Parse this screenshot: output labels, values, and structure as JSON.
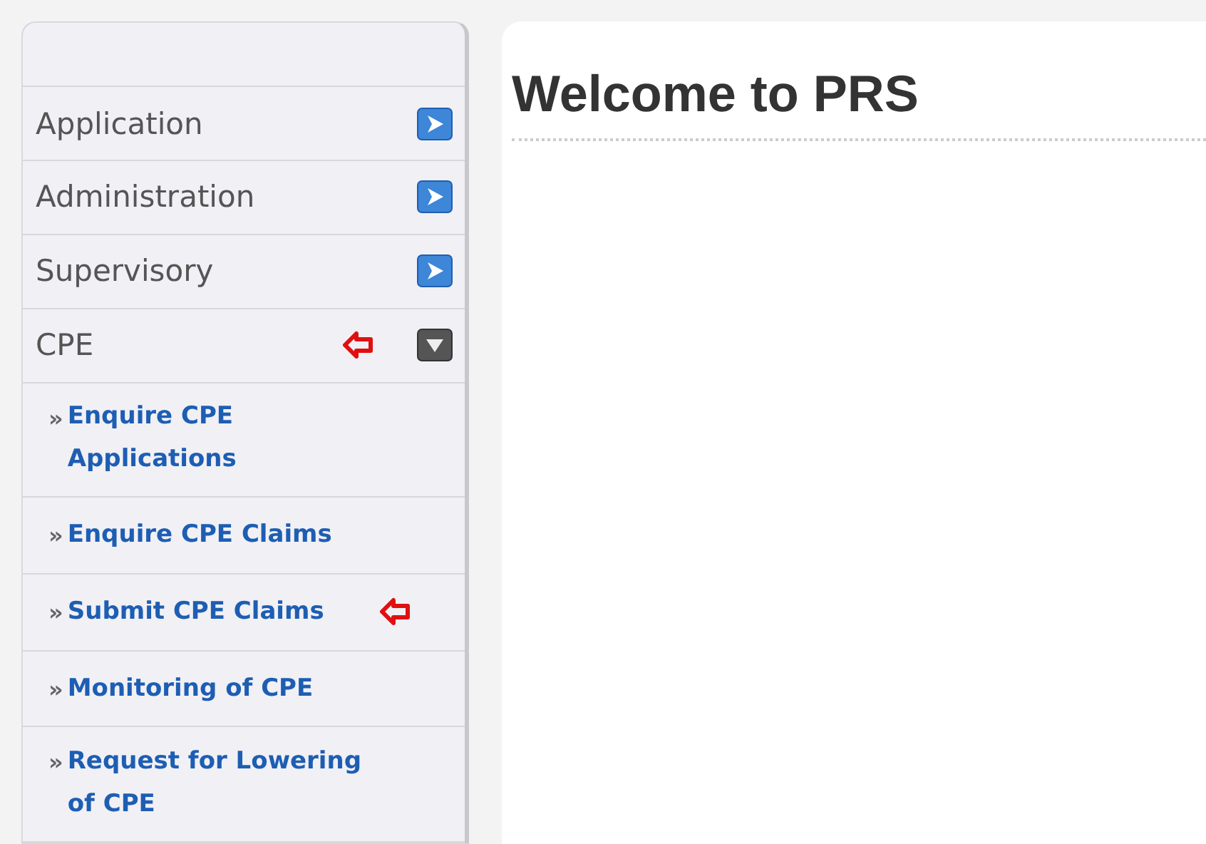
{
  "sidebar": {
    "sections": [
      {
        "label": "Application",
        "expanded": false,
        "marked": false
      },
      {
        "label": "Administration",
        "expanded": false,
        "marked": false
      },
      {
        "label": "Supervisory",
        "expanded": false,
        "marked": false
      },
      {
        "label": "CPE",
        "expanded": true,
        "marked": true,
        "children": [
          {
            "marker": "»",
            "label": "Enquire CPE Applications",
            "marked": false
          },
          {
            "marker": "»",
            "label": "Enquire CPE Claims",
            "marked": false
          },
          {
            "marker": "»",
            "label": "Submit CPE Claims",
            "marked": true
          },
          {
            "marker": "»",
            "label": "Monitoring of CPE",
            "marked": false
          },
          {
            "marker": "»",
            "label": "Request for Lowering of CPE",
            "marked": false
          }
        ]
      }
    ]
  },
  "main": {
    "title": "Welcome to PRS"
  }
}
